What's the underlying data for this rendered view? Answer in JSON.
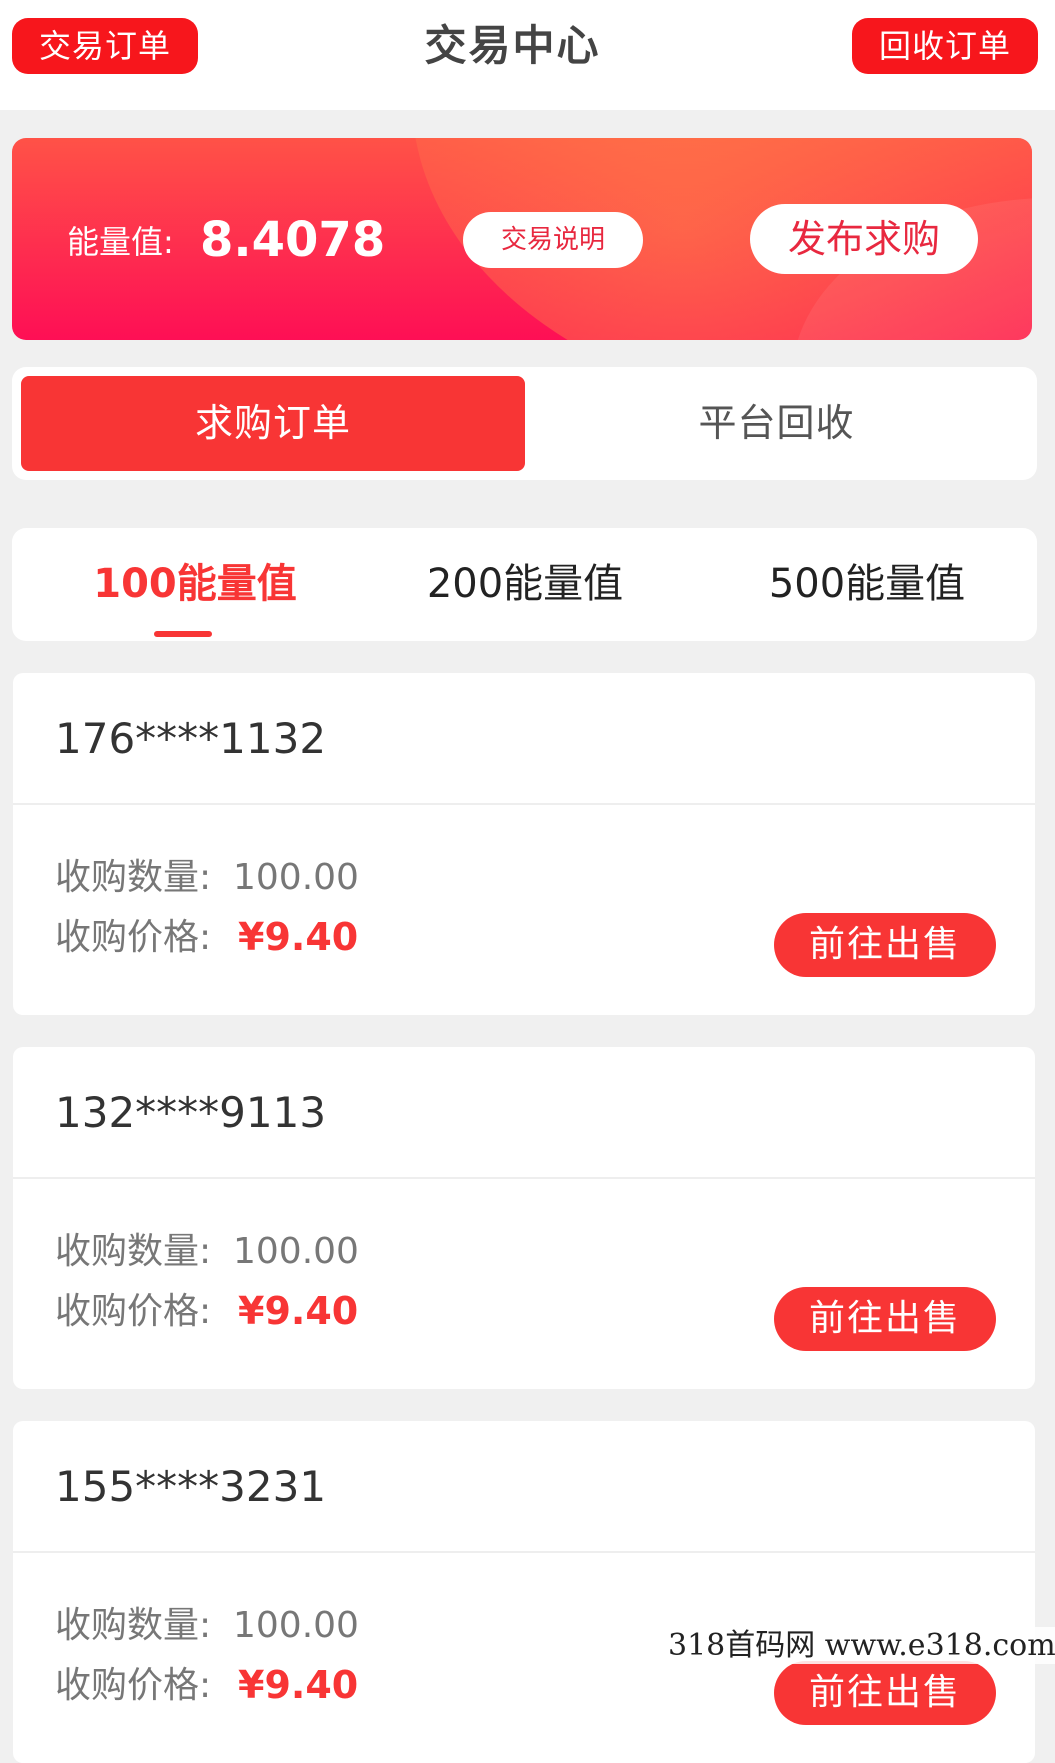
{
  "header": {
    "left_button": "交易订单",
    "title": "交易中心",
    "right_button": "回收订单"
  },
  "banner": {
    "energy_label": "能量值:",
    "energy_value": "8.4078",
    "explain_button": "交易说明",
    "publish_button": "发布求购"
  },
  "segment": {
    "active": "求购订单",
    "inactive": "平台回收"
  },
  "tabs": [
    {
      "label": "100能量值",
      "active": true
    },
    {
      "label": "200能量值",
      "active": false
    },
    {
      "label": "500能量值",
      "active": false
    }
  ],
  "orders": [
    {
      "phone": "176****1132",
      "qty_label": "收购数量:",
      "qty": "100.00",
      "price_label": "收购价格:",
      "price": "¥9.40",
      "sell_button": "前往出售"
    },
    {
      "phone": "132****9113",
      "qty_label": "收购数量:",
      "qty": "100.00",
      "price_label": "收购价格:",
      "price": "¥9.40",
      "sell_button": "前往出售"
    },
    {
      "phone": "155****3231",
      "qty_label": "收购数量:",
      "qty": "100.00",
      "price_label": "收购价格:",
      "price": "¥9.40",
      "sell_button": "前往出售"
    }
  ],
  "watermark": "318首码网  www.e318.com",
  "colors": {
    "accent": "#f83535",
    "banner_top": "#ff5247",
    "banner_bottom": "#fe0f55",
    "background": "#f0f0f0"
  }
}
